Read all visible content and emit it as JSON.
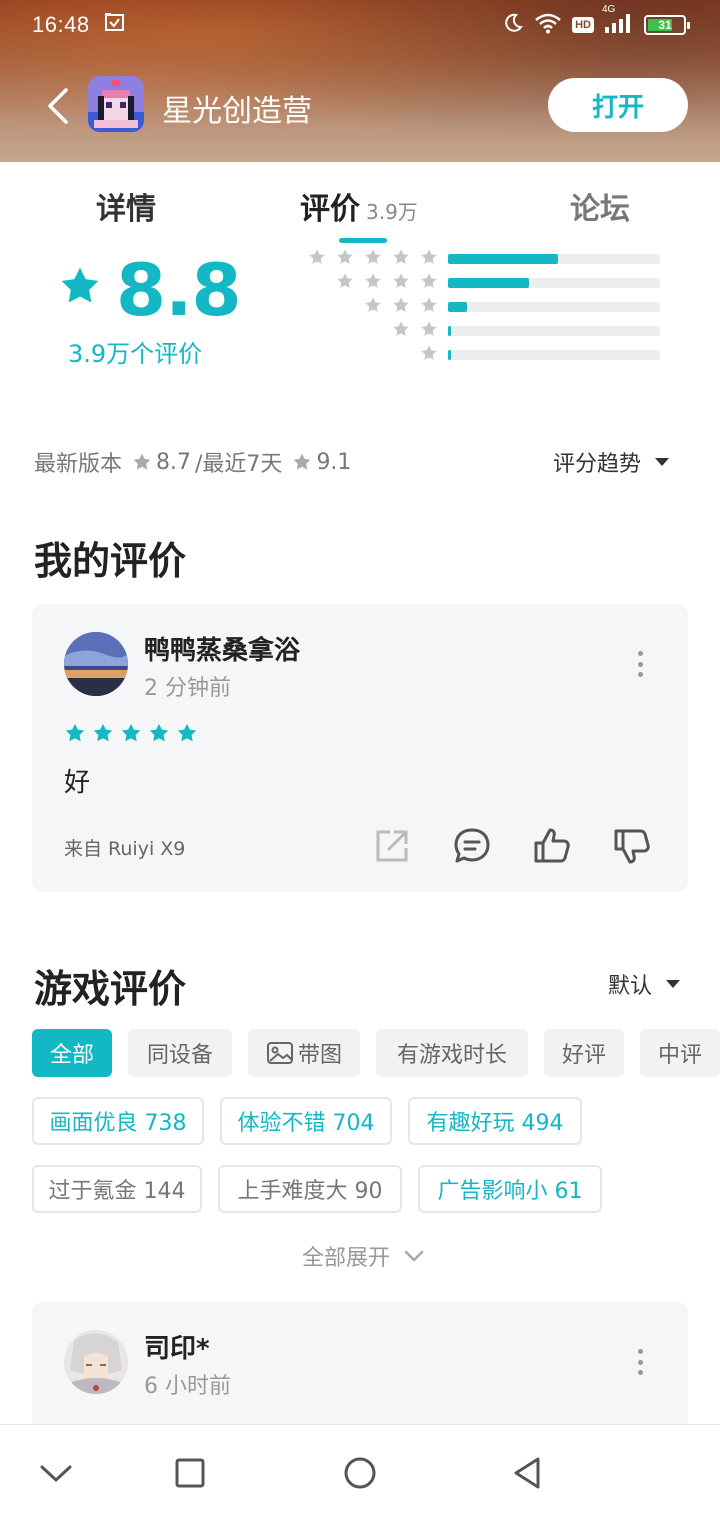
{
  "status_bar": {
    "time": "16:48",
    "network": "4G",
    "hd_badge": "HD",
    "battery": "31",
    "icons": [
      "screenshot-icon",
      "moon-icon",
      "wifi-icon",
      "signal-icon",
      "battery-icon"
    ]
  },
  "app": {
    "title": "星光创造营",
    "open_label": "打开"
  },
  "tabs": {
    "detail": "详情",
    "review": "评价",
    "review_count": "3.9万",
    "forum": "论坛",
    "active": "评价"
  },
  "rating": {
    "score": "8.8",
    "count_text": "3.9万个评价",
    "distribution": [
      {
        "stars": 5,
        "fraction": 0.52
      },
      {
        "stars": 4,
        "fraction": 0.38
      },
      {
        "stars": 3,
        "fraction": 0.09
      },
      {
        "stars": 2,
        "fraction": 0.015
      },
      {
        "stars": 1,
        "fraction": 0.015
      }
    ]
  },
  "version_row": {
    "latest_label": "最新版本",
    "latest_score": "8.7",
    "recent_label": "/最近7天",
    "recent_score": "9.1",
    "trend_label": "评分趋势"
  },
  "my_review": {
    "section_title": "我的评价",
    "user": "鸭鸭蒸桑拿浴",
    "time": "2 分钟前",
    "stars": 5,
    "text": "好",
    "device": "来自 Ruiyi X9"
  },
  "game_reviews": {
    "section_title": "游戏评价",
    "sort_label": "默认",
    "filters": [
      "全部",
      "同设备",
      "带图",
      "有游戏时长",
      "好评",
      "中评"
    ],
    "active_filter": "全部",
    "tags": [
      {
        "label": "画面优良 738",
        "tone": "positive"
      },
      {
        "label": "体验不错 704",
        "tone": "positive"
      },
      {
        "label": "有趣好玩 494",
        "tone": "positive"
      },
      {
        "label": "过于氪金 144",
        "tone": "negative"
      },
      {
        "label": "上手难度大 90",
        "tone": "negative"
      },
      {
        "label": "广告影响小 61",
        "tone": "positive"
      }
    ],
    "expand_label": "全部展开",
    "first_review": {
      "user": "司印*",
      "time": "6 小时前"
    }
  },
  "colors": {
    "accent": "#14b8c4",
    "star_gray": "#c4c6c8",
    "card_bg": "#f5f6f7"
  }
}
